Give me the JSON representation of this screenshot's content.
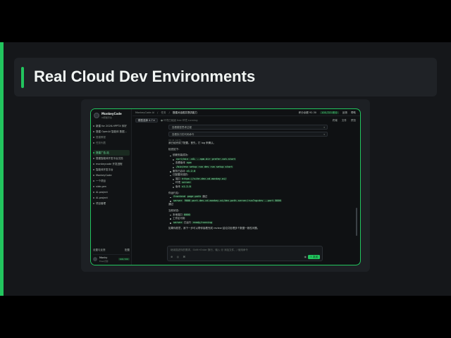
{
  "slide": {
    "title": "Real Cloud Dev Environments",
    "accent_color": "#22c55e"
  },
  "app": {
    "brand": {
      "name": "MonkeyCode",
      "sub": "AI研发平台"
    },
    "sidebar": {
      "items": [
        {
          "label": "新建 for 2026-HPPTX 你好"
        },
        {
          "label": "搭建 OpenAI 智能体 数据..."
        },
        {
          "label": "搭建教程"
        },
        {
          "label": "任务列表"
        }
      ],
      "projects": [
        {
          "label": "搭建广告-站",
          "active": true
        },
        {
          "label": "搭建智能体开发平台文档"
        },
        {
          "label": "monkeycode 开发进程"
        },
        {
          "label": "智能体开发平台"
        },
        {
          "label": "MonkeyCode"
        },
        {
          "label": "一个项目"
        },
        {
          "label": "side-gen"
        },
        {
          "label": "AI-project"
        },
        {
          "label": "AI-project"
        },
        {
          "label": "项目管理"
        }
      ],
      "footer": {
        "settings_label": "设置与反馈",
        "settings_right": "配置",
        "user_name": "Monky",
        "user_sub": "Free计划",
        "user_badge": "100,720"
      }
    },
    "header": {
      "crumbs": [
        "MonkeyCode AI",
        "/",
        "任务",
        "/"
      ],
      "current": "搭建对话框并提供能力",
      "points_label": "积分余额 92.30",
      "points_badge": "100,723 积分",
      "feedback": "反馈",
      "help": "帮助"
    },
    "toolbar": {
      "model": "模型选择 4.7 ▾",
      "status": "● 环境已就绪 free 环境 running",
      "actions": [
        "终端",
        "文件",
        "预览"
      ]
    },
    "chat": {
      "collapse_1": "查看模型思考过程",
      "collapse_2": "查看执行的代码命令",
      "time": "09:41 12/31",
      "intro": "我已经完成了配置。首先，打 log 来确认。",
      "summary_title": "检查如下：",
      "section_1_title": "依赖安装成功：",
      "section_1_cmd_1": "curl/bin -sSL --npm-dir prefer-ssh-start",
      "section_1_item_2": "查看版本",
      "section_1_item_2_code": "npm",
      "section_1_cmd_3": "/bin/env setup run dev run setup start",
      "section_1_item_4": "服务已启动",
      "section_1_item_4_code": "v1.2.0",
      "section_1_item_5": "已配置完成的：",
      "section_1_item_5a": "端口",
      "section_1_item_5a_code": "https://site.dev-cd.monkey.ai/",
      "section_1_item_5b": "环境",
      "section_1_item_5b_code": "server",
      "section_1_item_5c": "版本",
      "section_1_item_5c_code": "v1.2.0",
      "section_2_title": "你运行后：",
      "section_2_item_1_code": "frontend",
      "section_2_item_1_mid": "page-path",
      "section_2_item_1_tail": "通过",
      "section_2_item_2_label": "server",
      "section_2_item_2_code": "9000 port.dev-cd.monkey.ai/dev-path-server/run?ng=dev --port 8000",
      "section_2_item_2_tail": "通过",
      "section_3_title": "当前状态：",
      "section_3_item_1": "本地端口",
      "section_3_item_1_code": "8000",
      "section_3_item_2": "工作区可用",
      "section_3_item_3_code": "server",
      "section_3_item_3_mid": "已运行",
      "section_3_item_3_tail_code": "ready/running",
      "closing": "如果你愿意，我下一步可以帮你接着完成 review 结论并处理多个数据一致性问题。"
    },
    "composer": {
      "placeholder": "继续描述你的需求，Shift+Enter 换行，输入 @ 添加文件，/ 使用命令",
      "tools": [
        "⊕",
        "◎",
        "⌘"
      ],
      "mic": "◉",
      "send": "↑ 发送"
    }
  }
}
